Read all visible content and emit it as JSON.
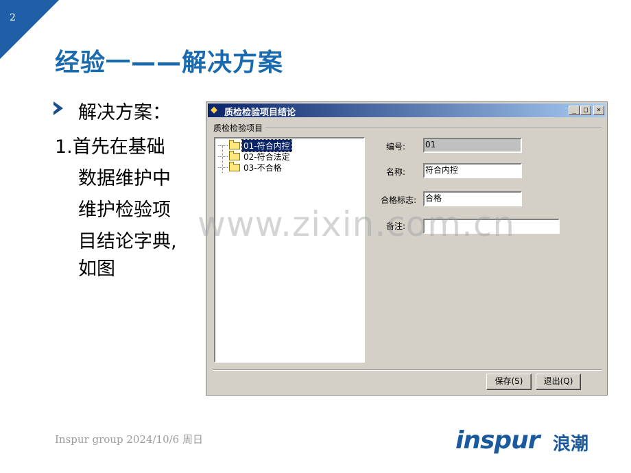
{
  "slide": {
    "page_number": "2",
    "title": "经验一——解决方案",
    "bullet": "解决方案：",
    "line1": "1.首先在基础",
    "line2": "数据维护中",
    "line3": "维护检验项",
    "line4": "目结论字典,",
    "line5": "如图",
    "watermark": "www.zixin.com.cn",
    "footer": "Inspur group   2024/10/6 周日",
    "logo": "inspur",
    "logo_cn": "浪潮",
    "accent_color": "#1a6ab0"
  },
  "dialog": {
    "title": "质检检验项目结论",
    "title_icon": "app-icon",
    "minimize": "_",
    "maximize": "□",
    "close": "×",
    "group_label": "质检检验项目",
    "tree_items": [
      "01-符合内控",
      "02-符合法定",
      "03-不合格"
    ],
    "selected_index": 0,
    "fields": {
      "code_label": "编号:",
      "code_value": "01",
      "name_label": "名称:",
      "name_value": "符合内控",
      "flag_label": "合格标志:",
      "flag_value": "合格",
      "note_label": "备注:",
      "note_value": ""
    },
    "buttons": {
      "save": "保存(S)",
      "exit": "退出(Q)"
    }
  }
}
